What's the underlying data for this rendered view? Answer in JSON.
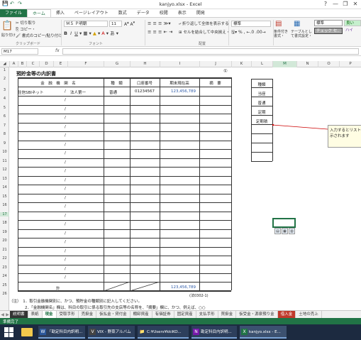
{
  "window": {
    "title": "kanjyo.xlsx - Excel",
    "quick_access": [
      "💾",
      "↶",
      "↷"
    ],
    "controls": [
      "?",
      "—",
      "❐",
      "✕"
    ]
  },
  "ribbon_tabs": [
    "ファイル",
    "ホーム",
    "挿入",
    "ページレイアウト",
    "数式",
    "データ",
    "校閲",
    "表示",
    "開発"
  ],
  "ribbon": {
    "cut": "切り取り",
    "copy": "コピー・",
    "format_painter": "書式のコピー/貼り付け",
    "paste": "貼り付け",
    "clipboard_label": "クリップボード",
    "font_name": "ＭＳ Ｐ明朝",
    "font_size": "11",
    "font_label": "フォント",
    "wrap_text": "折り返して全体を表示する",
    "merge": "セルを結合して中央揃え・",
    "align_label": "配置",
    "number_format": "標準",
    "conditional": "条件付き書式・",
    "table_format": "テーブルとして書式設定・",
    "style_standard": "標準",
    "style_check": "チェック セ..",
    "style_good": "良い",
    "style_bad": "ハイ"
  },
  "formula_bar": {
    "name_box": "M17",
    "fx": "fx",
    "value": ""
  },
  "columns": [
    "A",
    "B",
    "C",
    "D",
    "E",
    "F",
    "G",
    "H",
    "I",
    "J",
    "K",
    "L",
    "M",
    "N",
    "O",
    "P"
  ],
  "selected_column": "M",
  "rows": [
    "1",
    "2",
    "3",
    "4",
    "5",
    "6",
    "7",
    "8",
    "9",
    "10",
    "11",
    "12",
    "13",
    "14",
    "15",
    "16",
    "17",
    "18",
    "19",
    "20",
    "21",
    "22",
    "23",
    "24",
    "25",
    "26"
  ],
  "selected_row": "17",
  "sheet": {
    "page_num": "①",
    "title": "預貯金等の内訳書",
    "headers": [
      "金　融　機　関　名",
      "種　類",
      "口座番号",
      "期末現在高",
      "摘　要"
    ],
    "row1": {
      "bank": "住信SBIネット",
      "slash": "/",
      "branch": "法人第一",
      "type": "普通",
      "account": "01234567",
      "amount": "123,456,789"
    },
    "slash": "/",
    "total_label": "計",
    "total_amount": "123,456,789",
    "footnote_code": "(法0302-1)",
    "notes": [
      "（注）　1．取引金融機関別に、かつ、預貯金の種類別に記入してください。",
      "　　　　2．「金融機関名」欄は、科目の取引に係る取引先の支店等の名称を、「摘要」欄に、かつ、例えば、○○"
    ],
    "type_list_header": "種類",
    "type_list": [
      "当座",
      "普通",
      "定期",
      "定期積"
    ]
  },
  "tooltip": "入力するとリストに表示されます",
  "sheet_tabs": [
    "説明書",
    "表紙",
    "現金",
    "受取手形",
    "売掛金",
    "仮払金・貸付金",
    "棚卸資産",
    "有価証券",
    "固定資産",
    "支払手形",
    "買掛金",
    "仮受金・源泉預り金",
    "借入金",
    "土地の売上"
  ],
  "active_tab": "現金",
  "status": "準備完了",
  "taskbar": [
    {
      "icon": "W",
      "label": "「勘定科目内訳明..."
    },
    {
      "icon": "V",
      "label": "VIX - 野菜アルバム"
    },
    {
      "icon": "📁",
      "label": "C:¥Users¥kkiKO..."
    },
    {
      "icon": "N",
      "label": "勘定科目内訳明..."
    },
    {
      "icon": "X",
      "label": "kanjyo.xlsx - E..."
    }
  ],
  "colors": {
    "accent": "#217346",
    "tab_red": "#c0392b",
    "taskbar": "#1c2a40"
  }
}
